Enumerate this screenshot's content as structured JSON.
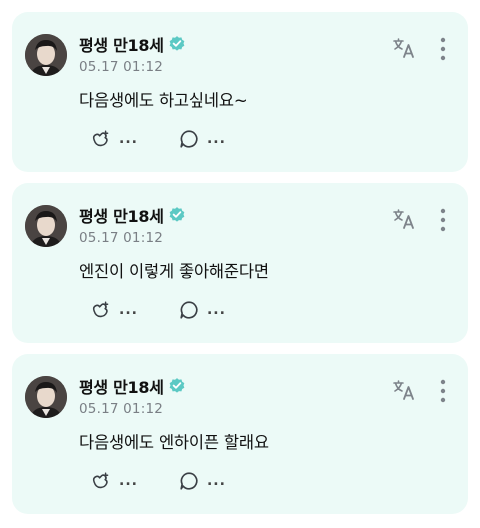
{
  "colors": {
    "card_bg": "#ecfaf7",
    "verified": "#5cc9c4",
    "accent": "#5cc9c4"
  },
  "posts": [
    {
      "author": "평생 만18세",
      "verified_icon": "verified-badge-icon",
      "timestamp": "05.17 01:12",
      "text": "다음생에도 하고싶네요~",
      "actions": {
        "react_count": "...",
        "reply_count": "..."
      }
    },
    {
      "author": "평생 만18세",
      "verified_icon": "verified-badge-icon",
      "timestamp": "05.17 01:12",
      "text": "엔진이 이렇게 좋아해준다면",
      "actions": {
        "react_count": "...",
        "reply_count": "..."
      }
    },
    {
      "author": "평생 만18세",
      "verified_icon": "verified-badge-icon",
      "timestamp": "05.17 01:12",
      "text": "다음생에도 엔하이픈 할래요",
      "actions": {
        "react_count": "...",
        "reply_count": "..."
      }
    }
  ]
}
